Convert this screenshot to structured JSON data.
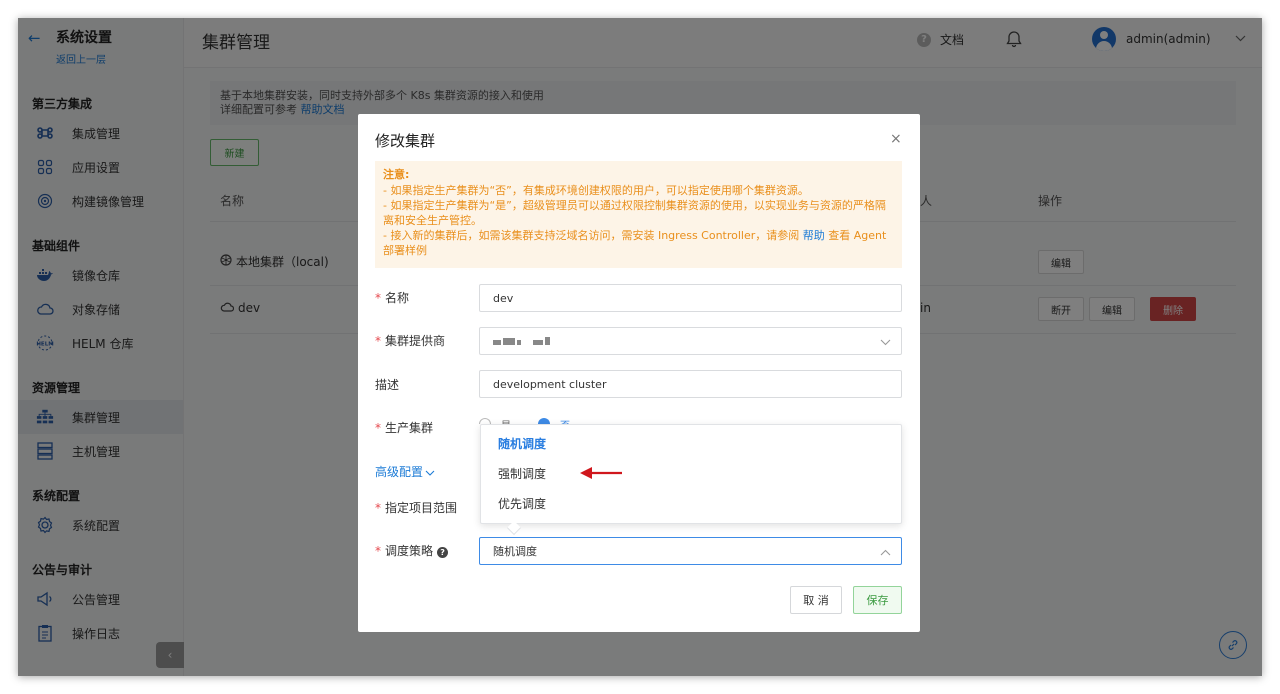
{
  "sidebar": {
    "back_title": "系统设置",
    "back_sub": "返回上一层",
    "groups": [
      {
        "title": "第三方集成",
        "items": [
          "集成管理",
          "应用设置",
          "构建镜像管理"
        ]
      },
      {
        "title": "基础组件",
        "items": [
          "镜像仓库",
          "对象存储",
          "HELM 仓库"
        ]
      },
      {
        "title": "资源管理",
        "items": [
          "集群管理",
          "主机管理"
        ]
      },
      {
        "title": "系统配置",
        "items": [
          "系统配置"
        ]
      },
      {
        "title": "公告与审计",
        "items": [
          "公告管理",
          "操作日志"
        ]
      }
    ],
    "collapse_glyph": "‹"
  },
  "header": {
    "page_title": "集群管理",
    "docs_label": "文档",
    "user_name": "admin(admin)"
  },
  "main": {
    "info_line1": "基于本地集群安装，同时支持外部多个 K8s 集群资源的接入和使用",
    "info_line2_prefix": "详细配置可参考 ",
    "info_link": "帮助文档",
    "new_button": "新建",
    "columns": {
      "name": "名称",
      "creator_tail": "人",
      "actions": "操作"
    },
    "rows": [
      {
        "name": "本地集群（local)",
        "actions": [
          "编辑"
        ]
      },
      {
        "name": "dev",
        "creator_tail": "in",
        "actions": [
          "断开",
          "编辑",
          "删除"
        ]
      }
    ]
  },
  "modal": {
    "title": "修改集群",
    "close": "×",
    "notice": {
      "heading": "注意:",
      "line1": "- 如果指定生产集群为“否”，有集成环境创建权限的用户，可以指定使用哪个集群资源。",
      "line2": "- 如果指定生产集群为“是”，超级管理员可以通过权限控制集群资源的使用，以实现业务与资源的严格隔离和安全生产管控。",
      "line3_prefix": "- 接入新的集群后，如需该集群支持泛域名访问，需安装 Ingress Controller，请参阅 ",
      "line3_link": "帮助",
      "line3_suffix": " 查看 Agent 部署样例"
    },
    "fields": {
      "name_label": "名称",
      "name_value": "dev",
      "provider_label": "集群提供商",
      "desc_label": "描述",
      "desc_value": "development cluster",
      "production_label": "生产集群",
      "production_peek_yes": "是",
      "production_peek_no": "否",
      "advanced_label": "高级配置",
      "scope_label": "指定项目范围",
      "strategy_label": "调度策略",
      "strategy_value": "随机调度"
    },
    "dropdown_options": [
      "随机调度",
      "强制调度",
      "优先调度"
    ],
    "cancel": "取 消",
    "save": "保存"
  },
  "colors": {
    "accent": "#1c7bd6",
    "success": "#3b9a40",
    "danger": "#d34646",
    "warning": "#e98f1c",
    "annotation": "#d0171d"
  }
}
